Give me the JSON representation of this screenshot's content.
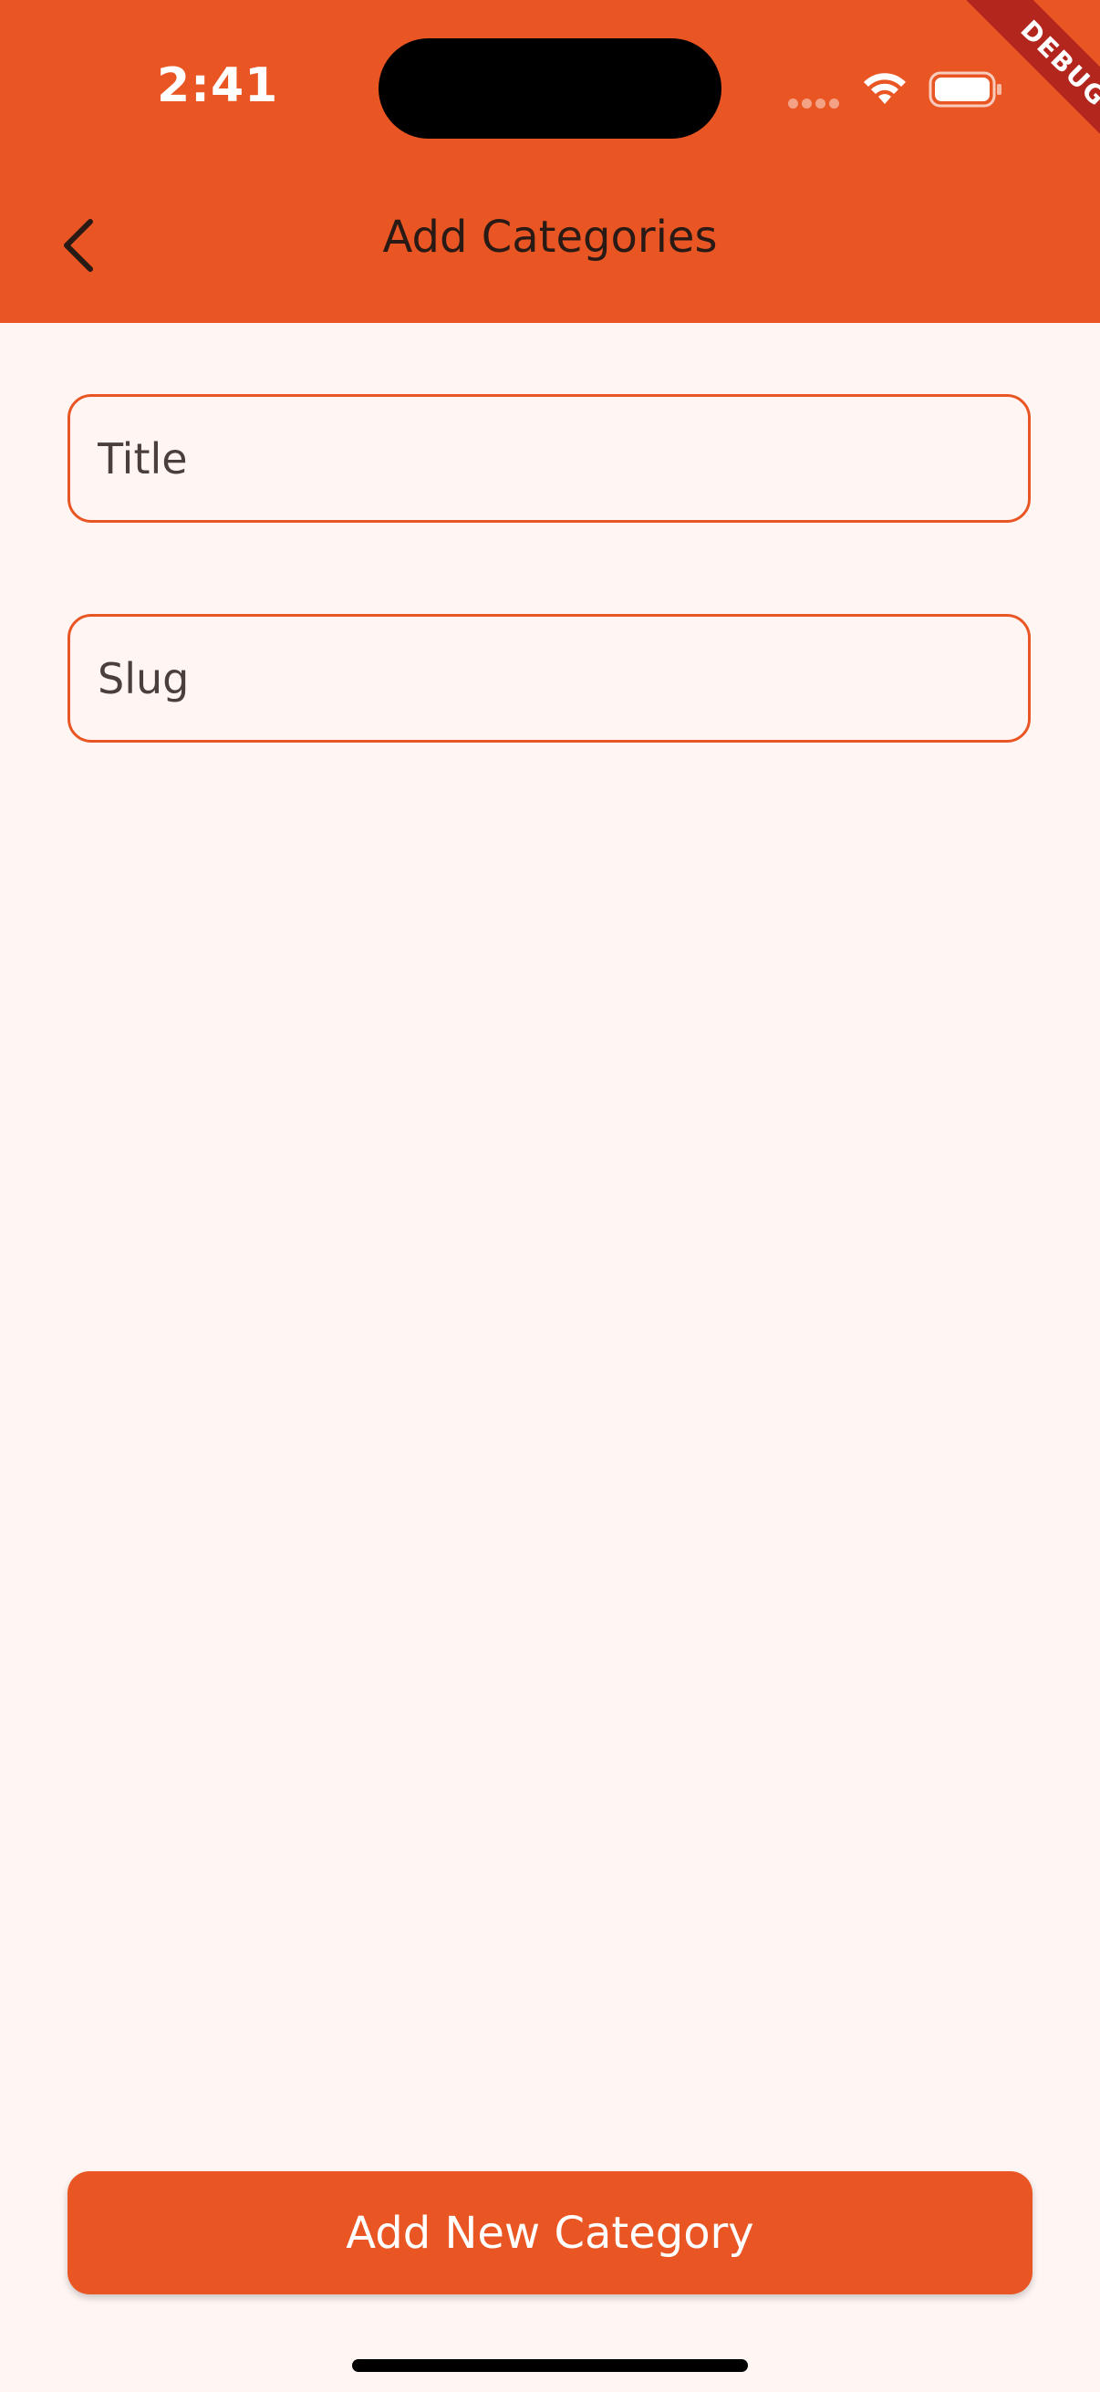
{
  "status_bar": {
    "time": "2:41",
    "debug_label": "DEBUG"
  },
  "app_bar": {
    "title": "Add Categories",
    "back_icon": "chevron-left-icon"
  },
  "form": {
    "title_placeholder": "Title",
    "slug_placeholder": "Slug"
  },
  "actions": {
    "submit_label": "Add New Category"
  },
  "colors": {
    "accent": "#E95624",
    "background": "#FFF6F4",
    "debug_ribbon": "#B3261E"
  }
}
